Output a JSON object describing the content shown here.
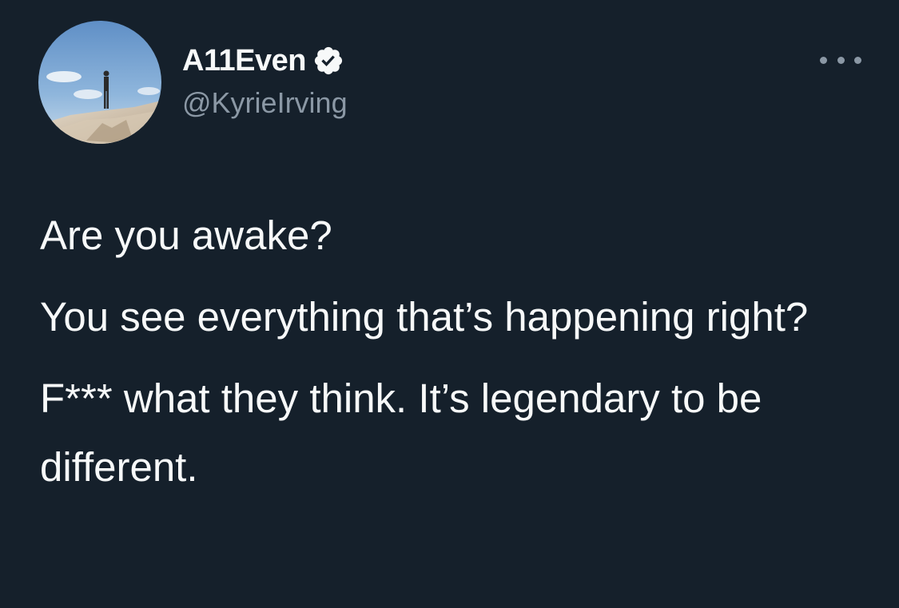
{
  "author": {
    "display_name": "A11Even",
    "handle": "@KyrieIrving",
    "verified": true,
    "avatar_icon": "profile-photo-person-on-sand-dune",
    "verified_icon": "verified-badge-icon"
  },
  "menu": {
    "icon": "more-options-icon"
  },
  "tweet": {
    "paragraphs": [
      "Are you awake?",
      "You see everything that’s happening right?",
      "F*** what they think. It’s legendary to be different."
    ]
  },
  "colors": {
    "background": "#15202b",
    "primary_text": "#f7f9f9",
    "secondary_text": "#8b98a5",
    "verified_badge": "#f7f9f9"
  }
}
